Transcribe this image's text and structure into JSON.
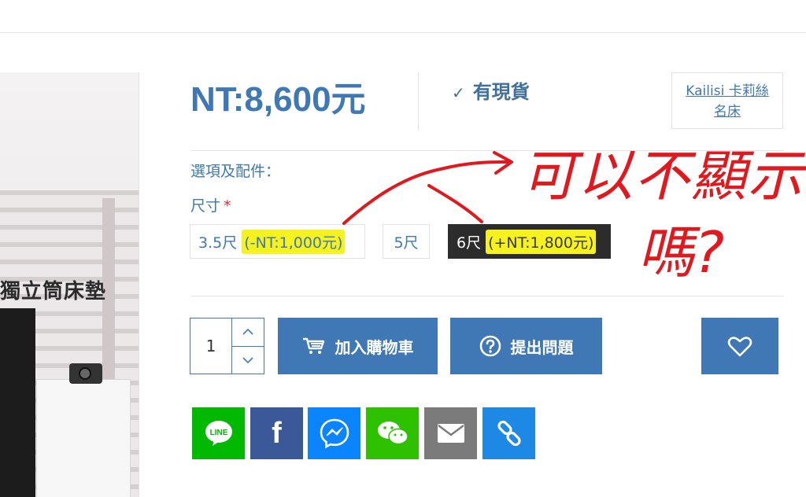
{
  "product_image": {
    "caption": "獨立筒床墊"
  },
  "price": "NT:8,600元",
  "stock": {
    "check_icon": "check-icon",
    "label": "有現貨"
  },
  "brand": {
    "line1": "Kailisi 卡莉絲",
    "line2": "名床"
  },
  "options": {
    "title": "選項及配件：",
    "size_label": "尺寸",
    "required_mark": "*",
    "items": [
      {
        "label": "3.5尺",
        "modifier": "(-NT:1,000元)",
        "selected": false
      },
      {
        "label": "5尺",
        "modifier": "",
        "selected": false
      },
      {
        "label": "6尺",
        "modifier": "(+NT:1,800元)",
        "selected": true
      }
    ]
  },
  "quantity": {
    "value": "1",
    "up_icon": "chevron-up-icon",
    "down_icon": "chevron-down-icon"
  },
  "buttons": {
    "add_to_cart": "加入購物車",
    "ask_question": "提出問題",
    "wishlist_icon": "heart-icon"
  },
  "share": [
    {
      "name": "line",
      "label": "LINE",
      "color": "#00b900"
    },
    {
      "name": "facebook",
      "label": "f",
      "color": "#3b5998"
    },
    {
      "name": "messenger",
      "label": "",
      "color": "#0a84ff"
    },
    {
      "name": "wechat",
      "label": "",
      "color": "#2dc100"
    },
    {
      "name": "email",
      "label": "",
      "color": "#7b7b7b"
    },
    {
      "name": "copy-link",
      "label": "",
      "color": "#1e88e5"
    }
  ],
  "annotation": {
    "line1": "可以不顯示",
    "line2": "嗎?",
    "color": "#e0191f"
  },
  "colors": {
    "accent": "#3f78b4",
    "highlight": "#f6f21f",
    "selected_option_bg": "#2c2c2c"
  }
}
